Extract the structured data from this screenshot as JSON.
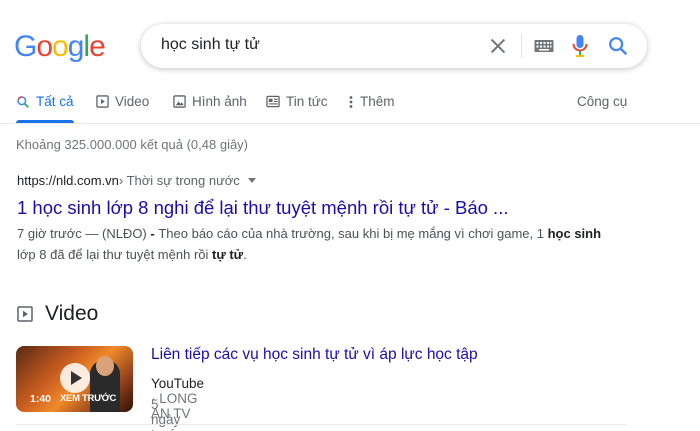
{
  "logo": {
    "letters": [
      "G",
      "o",
      "o",
      "g",
      "l",
      "e"
    ],
    "colors": [
      "#4285f4",
      "#ea4335",
      "#fbbc05",
      "#4285f4",
      "#34a853",
      "#ea4335"
    ]
  },
  "search": {
    "query": "học sinh tự tử"
  },
  "tabs": [
    {
      "label": "Tất cả",
      "icon": "search-icon",
      "active": true
    },
    {
      "label": "Video",
      "icon": "video-icon"
    },
    {
      "label": "Hình ảnh",
      "icon": "image-icon"
    },
    {
      "label": "Tin tức",
      "icon": "news-icon"
    },
    {
      "label": "Thêm",
      "icon": "more-icon"
    }
  ],
  "tools_label": "Công cụ",
  "stats": "Khoảng 325.000.000 kết quả (0,48 giây)",
  "result": {
    "url": "https://nld.com.vn",
    "breadcrumb": " › Thời sự trong nước",
    "title": "1 học sinh lớp 8 nghi để lại thư tuyệt mệnh rồi tự tử - Báo ...",
    "snippet_parts": [
      {
        "text": "7 giờ trước — (NLĐO) ",
        "bold": false
      },
      {
        "text": "- ",
        "bold": true
      },
      {
        "text": "Theo báo cáo của nhà trường, sau khi bị mẹ mắng vì chơi game, 1 ",
        "bold": false
      },
      {
        "text": "học sinh",
        "bold": true
      },
      {
        "text": " lớp 8 đã để lại thư tuyệt mệnh rồi ",
        "bold": false
      },
      {
        "text": "tự tử",
        "bold": true
      },
      {
        "text": ".",
        "bold": false
      }
    ]
  },
  "video_section": {
    "heading": "Video",
    "item": {
      "title": "Liên tiếp các vụ học sinh tự tử vì áp lực học tập",
      "source": "YouTube",
      "separator": " · ",
      "channel": "LONG AN TV",
      "date": "5 ngày trước",
      "duration": "1:40",
      "overlay_text": "XEM TRƯỚC"
    }
  }
}
